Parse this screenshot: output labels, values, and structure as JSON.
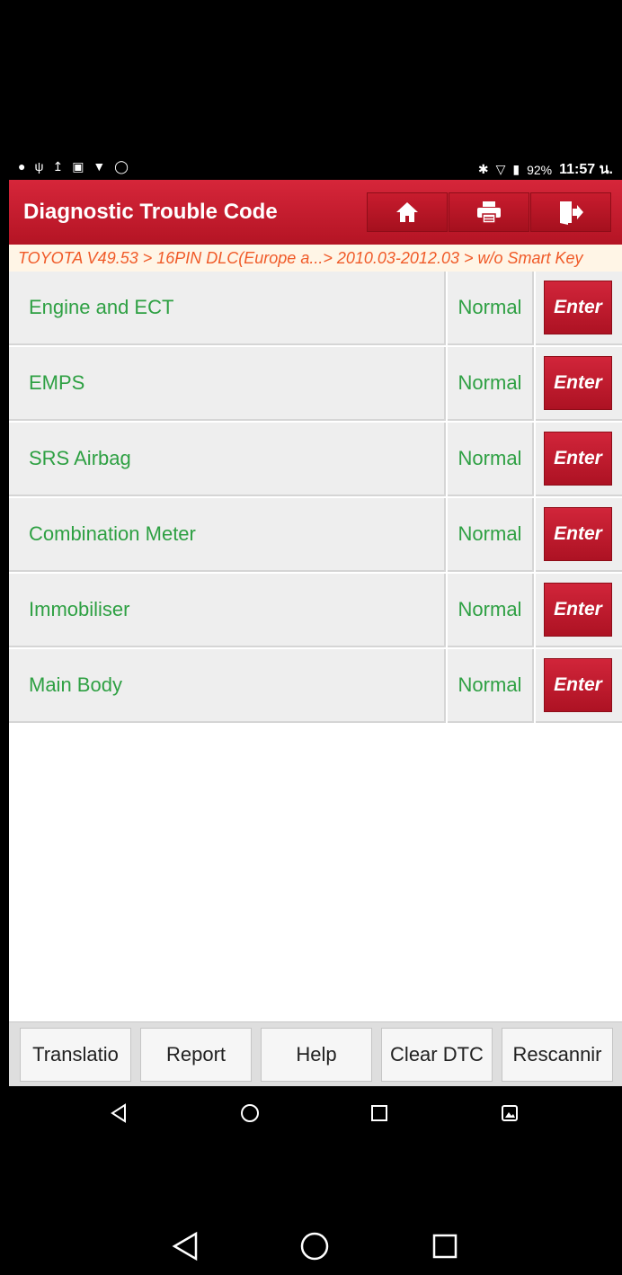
{
  "status_bar": {
    "battery": "92%",
    "time": "11:57 น."
  },
  "header": {
    "title": "Diagnostic Trouble Code",
    "buttons": [
      {
        "icon": "home-icon"
      },
      {
        "icon": "print-icon"
      },
      {
        "icon": "exit-icon"
      }
    ]
  },
  "breadcrumb": "TOYOTA V49.53 > 16PIN DLC(Europe a...> 2010.03-2012.03 > w/o Smart Key",
  "systems": [
    {
      "name": "Engine and ECT",
      "status": "Normal",
      "action": "Enter"
    },
    {
      "name": "EMPS",
      "status": "Normal",
      "action": "Enter"
    },
    {
      "name": "SRS Airbag",
      "status": "Normal",
      "action": "Enter"
    },
    {
      "name": "Combination Meter",
      "status": "Normal",
      "action": "Enter"
    },
    {
      "name": "Immobiliser",
      "status": "Normal",
      "action": "Enter"
    },
    {
      "name": "Main Body",
      "status": "Normal",
      "action": "Enter"
    }
  ],
  "toolbar": {
    "translation": "Translatio",
    "report": "Report",
    "help": "Help",
    "clear_dtc": "Clear DTC",
    "rescanning": "Rescannir"
  },
  "colors": {
    "header_red": "#c81c2e",
    "system_text_green": "#2ea043",
    "breadcrumb_orange": "#f05a28"
  }
}
